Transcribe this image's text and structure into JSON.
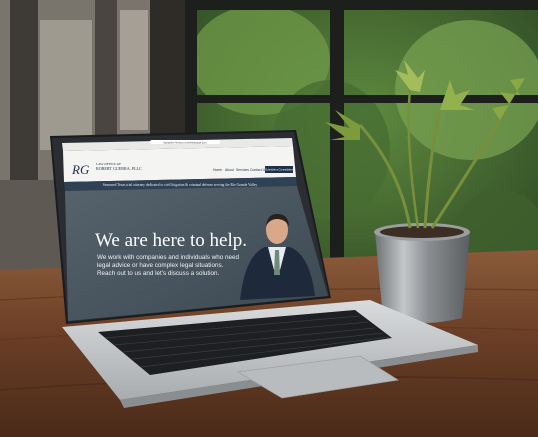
{
  "browser": {
    "address": "rbgrapher-lexaw.io.cwebsitepage.com"
  },
  "site": {
    "logo_letters": "RG",
    "logo_line1": "LAW OFFICE OF",
    "logo_line2": "ROBERT GUERRA, PLLC",
    "nav": [
      "Home",
      "About",
      "Services",
      "Contact Us"
    ],
    "cta": "Schedule a Consultation",
    "tagline": "Seasoned Texas trial attorney dedicated to civil litigation & criminal defense serving the Rio Grande Valley",
    "hero_heading": "We are here to help.",
    "hero_body_lines": [
      "We work with companies and individuals who need",
      "legal advice or have complex legal situations.",
      "Reach out to us and let's discuss a solution."
    ]
  },
  "colors": {
    "header_bg": "#f4f4f2",
    "tagline_bar": "#2f4154",
    "hero_bg": "#4a5a67",
    "cta_bg": "#1f3148",
    "laptop_silver": "#c7c9cb",
    "table_wood": "#6b3f26"
  }
}
